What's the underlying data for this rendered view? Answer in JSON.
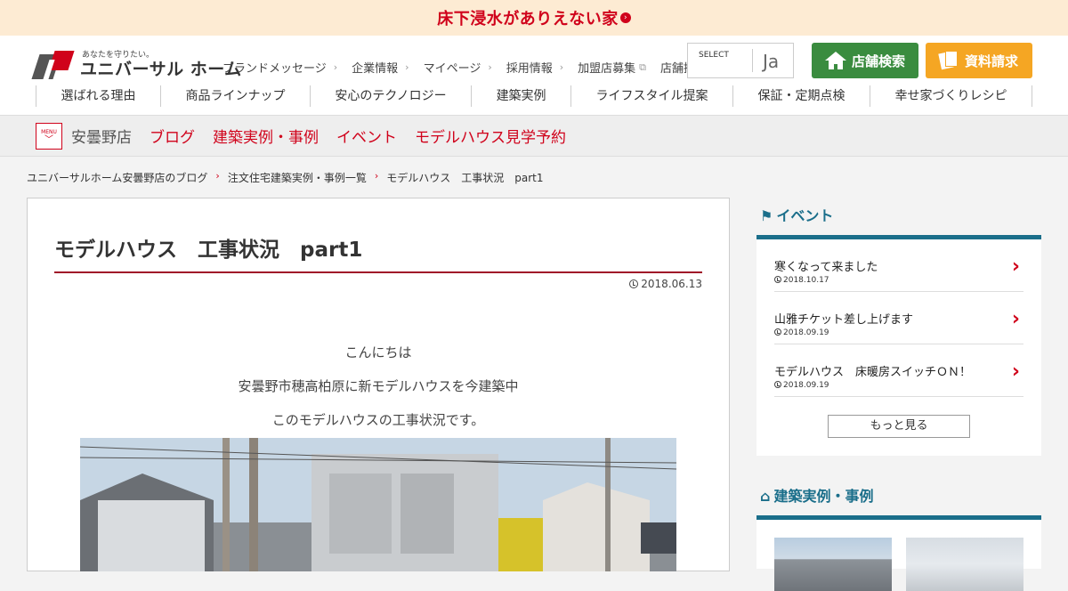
{
  "banner": {
    "text": "床下浸水がありえない家",
    "arrow": "›"
  },
  "logo": {
    "tagline": "あなたを守りたい。",
    "name": "ユニバーサル ホーム"
  },
  "utility_nav": [
    {
      "label": "ブランドメッセージ",
      "marker": "›"
    },
    {
      "label": "企業情報",
      "marker": "›"
    },
    {
      "label": "マイページ",
      "marker": "›"
    },
    {
      "label": "採用情報",
      "marker": "›"
    },
    {
      "label": "加盟店募集",
      "marker": "⧉"
    },
    {
      "label": "店舗採用情報",
      "marker": "⧉"
    }
  ],
  "language": {
    "label": "SELECT",
    "value": "Ja"
  },
  "header_buttons": {
    "store_search": "店舗検索",
    "request_docs": "資料請求"
  },
  "main_nav": [
    "選ばれる理由",
    "商品ラインナップ",
    "安心のテクノロジー",
    "建築実例",
    "ライフスタイル提案",
    "保証・定期点検",
    "幸せ家づくりレシピ"
  ],
  "store_bar": {
    "menu_label": "MENU",
    "store_name": "安曇野店",
    "links": [
      "ブログ",
      "建築実例・事例",
      "イベント",
      "モデルハウス見学予約"
    ]
  },
  "breadcrumb": [
    "ユニバーサルホーム安曇野店のブログ",
    "注文住宅建築実例・事例一覧",
    "モデルハウス　工事状況　part1"
  ],
  "article": {
    "title": "モデルハウス　工事状況　part1",
    "date": "2018.06.13",
    "paragraphs": [
      "こんにちは",
      "安曇野市穂高柏原に新モデルハウスを今建築中",
      "このモデルハウスの工事状況です。"
    ]
  },
  "sidebar": {
    "events_title": "イベント",
    "events": [
      {
        "title": "寒くなって来ました",
        "date": "2018.10.17"
      },
      {
        "title": "山雅チケット差し上げます",
        "date": "2018.09.19"
      },
      {
        "title": "モデルハウス　床暖房スイッチＯＮ！",
        "date": "2018.09.19"
      }
    ],
    "more_label": "もっと見る",
    "works_title": "建築実例・事例"
  },
  "colors": {
    "brand_red": "#d0021b",
    "accent_teal": "#1a6e8a",
    "store_green": "#3a8c3f",
    "docs_orange": "#f5a623",
    "banner_bg": "#fdebd3"
  }
}
